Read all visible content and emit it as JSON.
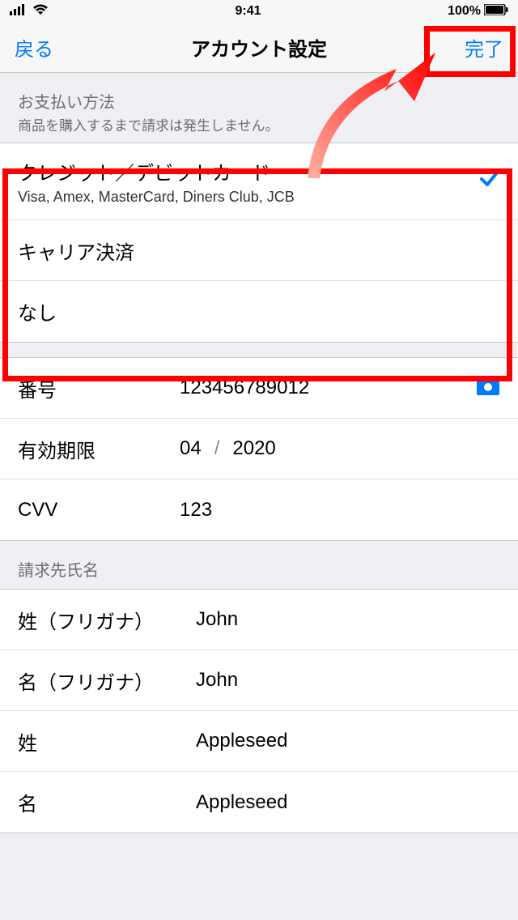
{
  "status": {
    "time": "9:41",
    "battery": "100%"
  },
  "nav": {
    "back": "戻る",
    "title": "アカウント設定",
    "done": "完了"
  },
  "payment_section": {
    "title": "お支払い方法",
    "subtitle": "商品を購入するまで請求は発生しません。"
  },
  "payment_options": [
    {
      "label": "クレジット／デビットカード",
      "sub": "Visa, Amex, MasterCard, Diners Club, JCB",
      "selected": true
    },
    {
      "label": "キャリア決済",
      "sub": "",
      "selected": false
    },
    {
      "label": "なし",
      "sub": "",
      "selected": false
    }
  ],
  "card": {
    "number_label": "番号",
    "number_value": "123456789012",
    "exp_label": "有効期限",
    "exp_month": "04",
    "exp_year": "2020",
    "cvv_label": "CVV",
    "cvv_value": "123"
  },
  "billing_section": {
    "title": "請求先氏名"
  },
  "billing": [
    {
      "label": "姓（フリガナ）",
      "value": "John"
    },
    {
      "label": "名（フリガナ）",
      "value": "John"
    },
    {
      "label": "姓",
      "value": "Appleseed"
    },
    {
      "label": "名",
      "value": "Appleseed"
    }
  ]
}
